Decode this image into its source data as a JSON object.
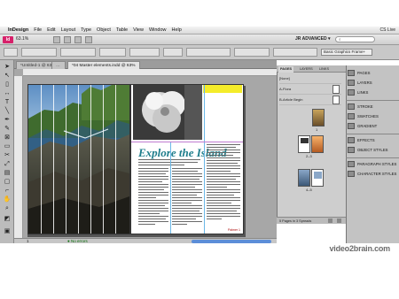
{
  "menubar": {
    "app_name": "InDesign",
    "items": [
      "File",
      "Edit",
      "Layout",
      "Type",
      "Object",
      "Table",
      "View",
      "Window",
      "Help"
    ],
    "right_label": "CS Live"
  },
  "appbar": {
    "logo": "Id",
    "zoom": "63.1%",
    "workspace": "JR ADVANCED ▾",
    "search_placeholder": ""
  },
  "control_bar": {
    "frame_fitting": "Basic Graphics Frame+"
  },
  "tabs": [
    {
      "label": "*Untitled-1 @ 63%",
      "active": false
    },
    {
      "label": "*04 Master elements.indd @ 63%",
      "active": false
    },
    {
      "label": "*04 Master elements.indd @ 63%",
      "active": true
    }
  ],
  "page": {
    "headline": "Explore the Island",
    "folio": "Palmer 1"
  },
  "status": {
    "page_number": "1",
    "preflight": "● No errors"
  },
  "pages_panel": {
    "tabs": [
      "PAGES",
      "LAYERS",
      "LINKS"
    ],
    "masters": [
      "[None]",
      "A-Flora",
      "B-Article Begin"
    ],
    "page_labels": [
      "1",
      "2–3",
      "4–5"
    ],
    "footer": "5 Pages in 3 Spreads"
  },
  "dock": {
    "items": [
      {
        "label": "PAGES",
        "icon": "pages-icon"
      },
      {
        "label": "LAYERS",
        "icon": "layers-icon"
      },
      {
        "label": "LINKS",
        "icon": "links-icon"
      },
      {
        "label": "STROKE",
        "icon": "stroke-icon"
      },
      {
        "label": "SWATCHES",
        "icon": "swatches-icon"
      },
      {
        "label": "GRADIENT",
        "icon": "gradient-icon"
      },
      {
        "label": "EFFECTS",
        "icon": "effects-icon"
      },
      {
        "label": "OBJECT STYLES",
        "icon": "object-styles-icon"
      },
      {
        "label": "PARAGRAPH STYLES",
        "icon": "paragraph-styles-icon"
      },
      {
        "label": "CHARACTER STYLES",
        "icon": "character-styles-icon"
      }
    ]
  },
  "watermark": "video2brain.com",
  "colors": {
    "headline": "#1f7e8c",
    "accent_band": "#f4ec2a",
    "indesign_brand": "#d7206a"
  }
}
